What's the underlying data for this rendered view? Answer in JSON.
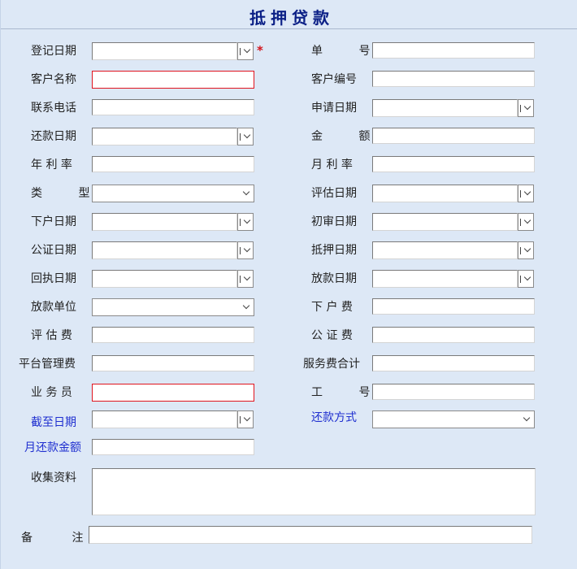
{
  "form": {
    "title": "抵押贷款",
    "required_mark": "*",
    "left": {
      "reg_date": "登记日期",
      "customer_name": "客户名称",
      "phone": "联系电话",
      "repay_date": "还款日期",
      "annual_rate": "年 利 率",
      "type": "类 型",
      "transfer_date": "下户日期",
      "notary_date": "公证日期",
      "receipt_date": "回执日期",
      "lender": "放款单位",
      "appraisal_fee": "评 估 费",
      "platform_fee": "平台管理费",
      "salesman": "业 务 员",
      "deadline": "截至日期",
      "monthly_repay": "月还款金额",
      "materials": "收集资料",
      "remark": "备 注"
    },
    "right": {
      "order_no": "单 号",
      "customer_no": "客户编号",
      "apply_date": "申请日期",
      "amount": "金 额",
      "monthly_rate": "月 利 率",
      "appraise_date": "评估日期",
      "review_date": "初审日期",
      "mortgage_date": "抵押日期",
      "loan_date": "放款日期",
      "transfer_fee": "下 户 费",
      "notary_fee": "公 证 费",
      "service_total": "服务费合计",
      "employee_no": "工 号",
      "repay_method": "还款方式"
    }
  },
  "colors": {
    "background": "#dde8f6",
    "title": "#0a1f86",
    "required_border": "#e0141e",
    "blue_label": "#1f2fd0"
  },
  "icons": {
    "dropdown": "chevron-down-icon"
  }
}
